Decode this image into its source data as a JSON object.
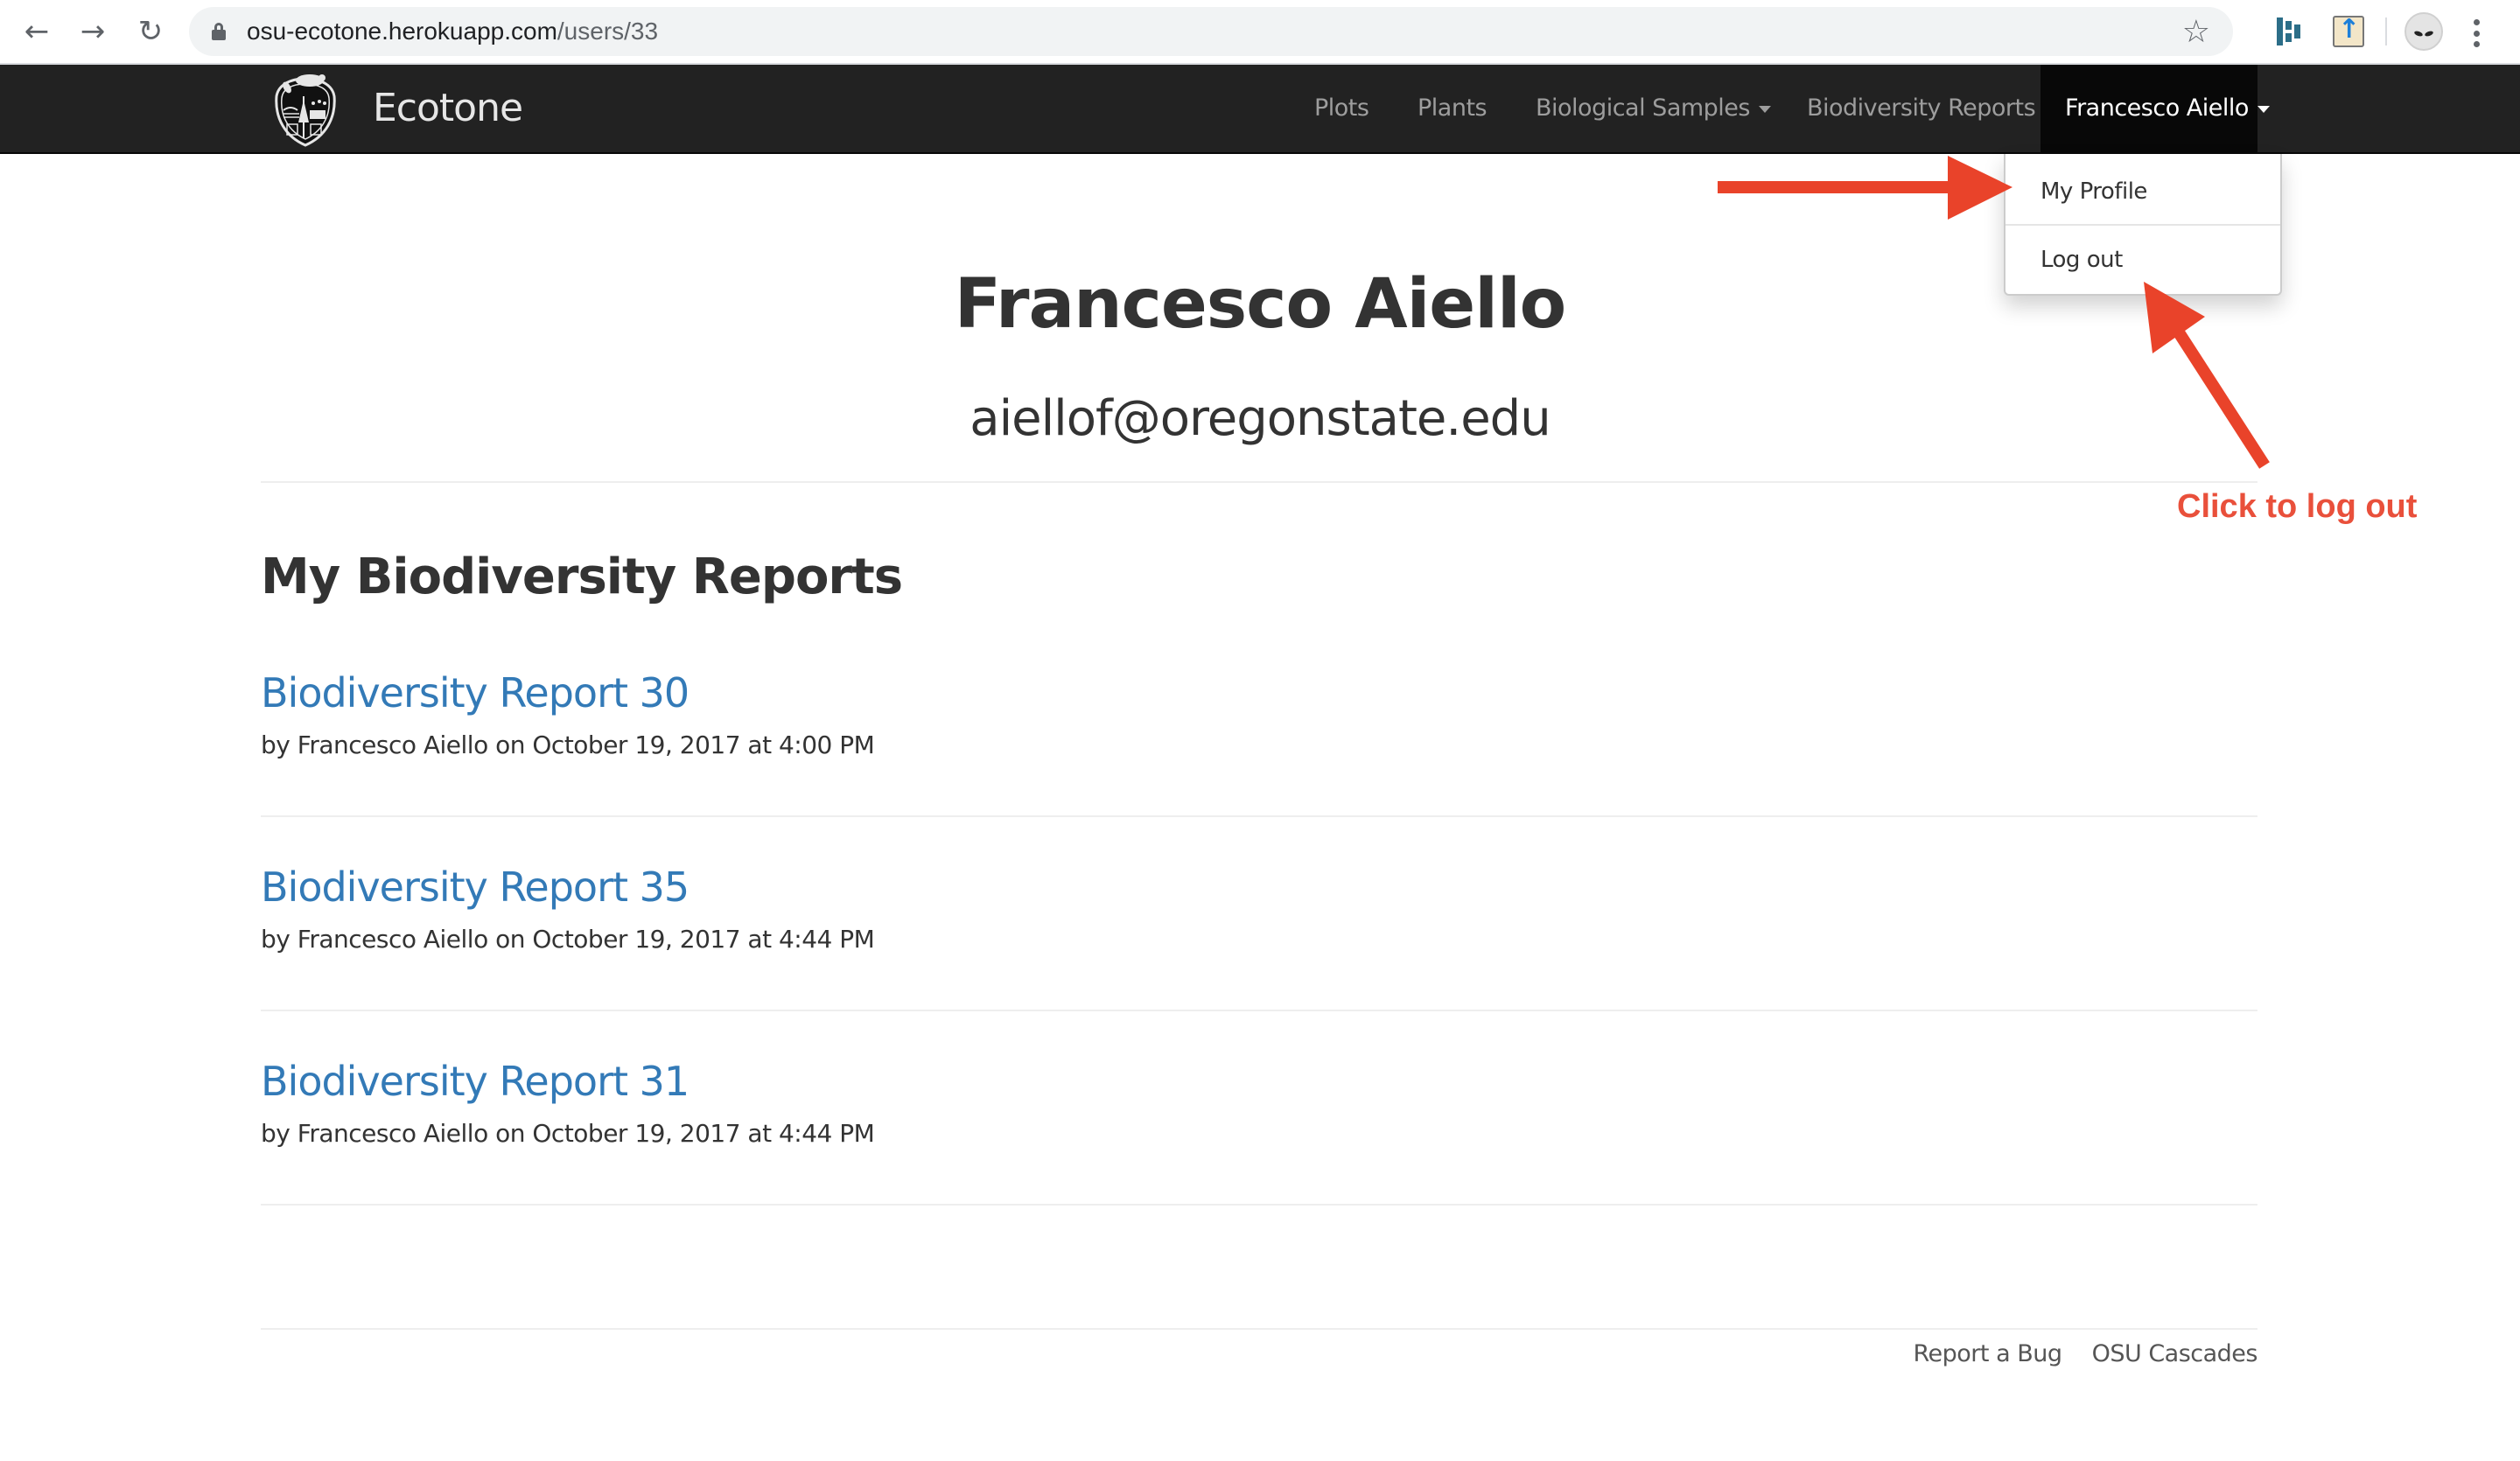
{
  "browser": {
    "back_icon": "arrow-left-icon",
    "forward_icon": "arrow-right-icon",
    "reload_icon": "reload-icon",
    "url_host": "osu-ecotone.herokuapp.com",
    "url_path": "/users/33",
    "bookmark_icon": "star-icon",
    "extensions": [
      "bar-chart-extension-icon",
      "upload-book-extension-icon"
    ],
    "profile_icon": "alien-avatar-icon",
    "menu_icon": "kebab-menu-icon"
  },
  "navbar": {
    "brand": "Ecotone",
    "logo": "osu-beaver-crest-logo",
    "items": [
      {
        "label": "Plots",
        "has_caret": false
      },
      {
        "label": "Plants",
        "has_caret": false
      },
      {
        "label": "Biological Samples",
        "has_caret": true
      },
      {
        "label": "Biodiversity Reports",
        "has_caret": false
      }
    ],
    "user_menu": {
      "label": "Francesco Aiello",
      "open": true,
      "items": [
        {
          "label": "My Profile"
        },
        {
          "label": "Log out"
        }
      ]
    }
  },
  "profile": {
    "name": "Francesco Aiello",
    "email": "aiellof@oregonstate.edu"
  },
  "reports_section": {
    "title": "My Biodiversity Reports",
    "reports": [
      {
        "title": "Biodiversity Report 30",
        "meta": "by Francesco Aiello on October 19, 2017 at 4:00 PM"
      },
      {
        "title": "Biodiversity Report 35",
        "meta": "by Francesco Aiello on October 19, 2017 at 4:44 PM"
      },
      {
        "title": "Biodiversity Report 31",
        "meta": "by Francesco Aiello on October 19, 2017 at 4:44 PM"
      }
    ]
  },
  "footer": {
    "links": [
      "Report a Bug",
      "OSU Cascades"
    ]
  },
  "annotation": {
    "text": "Click to log out",
    "color": "#e9503b"
  },
  "colors": {
    "navbar_bg": "#222222",
    "navbar_active_bg": "#080808",
    "link": "#337ab7",
    "text": "#333333"
  }
}
